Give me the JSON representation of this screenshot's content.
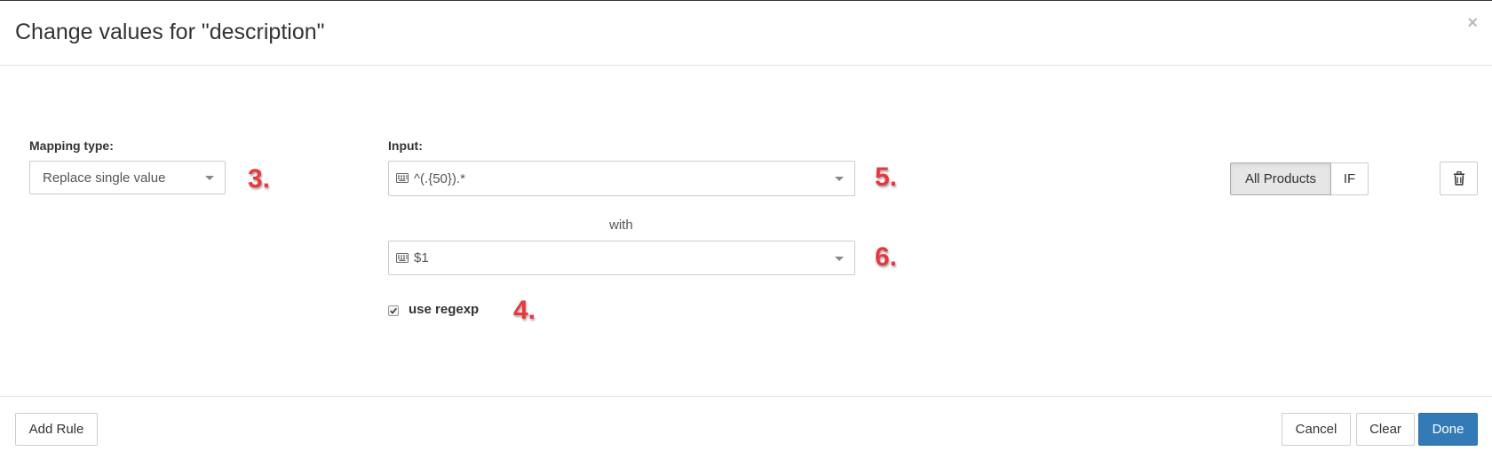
{
  "dialog": {
    "title": "Change values for \"description\"",
    "close_label": "×"
  },
  "mapping": {
    "label": "Mapping type:",
    "value": "Replace single value"
  },
  "input": {
    "label": "Input:",
    "value": "^(.{50}).*"
  },
  "with_label": "with",
  "replacement": {
    "value": "$1"
  },
  "regexp": {
    "label": "use regexp",
    "checked": true
  },
  "scope": {
    "all_products": "All Products",
    "if": "IF"
  },
  "annotations": {
    "mapping": "3.",
    "regexp": "4.",
    "input": "5.",
    "replacement": "6."
  },
  "footer": {
    "add_rule": "Add Rule",
    "cancel": "Cancel",
    "clear": "Clear",
    "done": "Done"
  },
  "colors": {
    "primary": "#337ab7",
    "annotation": "#e8383d"
  }
}
